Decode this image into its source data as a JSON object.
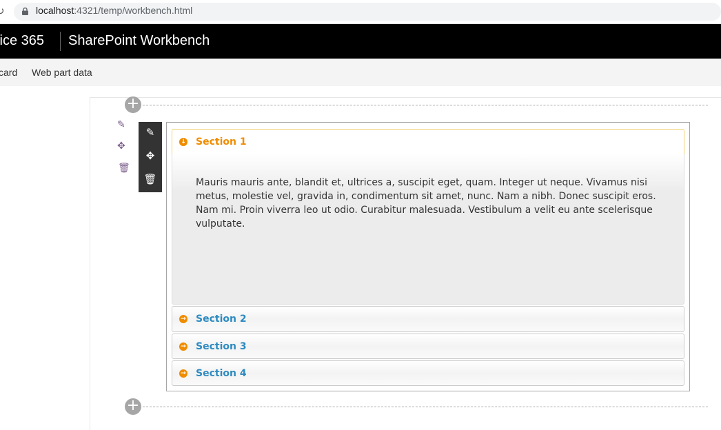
{
  "browser": {
    "url_host": "localhost",
    "url_rest": ":4321/temp/workbench.html"
  },
  "suite": {
    "brand": "fice 365",
    "title": "SharePoint Workbench"
  },
  "commands": [
    "card",
    "Web part data"
  ],
  "accordion": {
    "sections": [
      {
        "label": "Section 1",
        "expanded": true,
        "content": "Mauris mauris ante, blandit et, ultrices a, suscipit eget, quam. Integer ut neque. Vivamus nisi metus, molestie vel, gravida in, condimentum sit amet, nunc. Nam a nibh. Donec suscipit eros. Nam mi. Proin viverra leo ut odio. Curabitur malesuada. Vestibulum a velit eu ante scelerisque vulputate."
      },
      {
        "label": "Section 2",
        "expanded": false
      },
      {
        "label": "Section 3",
        "expanded": false
      },
      {
        "label": "Section 4",
        "expanded": false
      }
    ],
    "colors": {
      "active": "#ef8c00",
      "inactive": "#2e8bc0",
      "icon": "#ef8c00"
    }
  }
}
